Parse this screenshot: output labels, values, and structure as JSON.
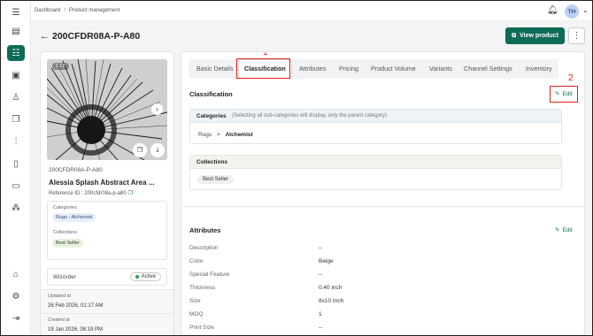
{
  "breadcrumb": {
    "root": "Dashboard",
    "sep": "/",
    "current": "Product management"
  },
  "user": {
    "initials": "TH"
  },
  "page": {
    "title": "200CFDR08A-P-A80",
    "view_button": "View product"
  },
  "product": {
    "image_counter": "1 / 2",
    "sku": "200CFDR08A-P-A80",
    "name": "Alessia Splash Abstract Area ...",
    "reference": "Reference ID : 200cfdr08a-p-a80",
    "categories_label": "Categories",
    "category_parent": "Rugs",
    "category_child": "Alchemist",
    "collections_label": "Collections",
    "collection": "Best Seller",
    "wizorder_label": "Wizorder",
    "status": "Active",
    "updated_label": "Updated at",
    "updated_value": "26 Feb 2026, 01:17 AM",
    "created_label": "Created at",
    "created_value": "19 Jan 2026, 08:19 PM"
  },
  "tabs": [
    "Basic Details",
    "Classification",
    "Attributes",
    "Pricing",
    "Product Volume",
    "Variants",
    "Channel Settings",
    "Inventory"
  ],
  "active_tab": "Classification",
  "annotations": {
    "n1": "1",
    "n2": "2"
  },
  "classification": {
    "heading": "Classification",
    "edit": "Edit",
    "categories_title": "Categories",
    "categories_note": "(Selecting all sub-categories will display, only the parent category)",
    "path_parent": "Rugs",
    "path_sep": ">",
    "path_child": "Alchemist",
    "collections_title": "Collections",
    "collection_chip": "Best Seller"
  },
  "attributes": {
    "heading": "Attributes",
    "edit": "Edit",
    "rows": [
      {
        "label": "Description",
        "value": "--"
      },
      {
        "label": "Color",
        "value": "Beige"
      },
      {
        "label": "Special Feature",
        "value": "--"
      },
      {
        "label": "Thickness",
        "value": "0.40 inch"
      },
      {
        "label": "Size",
        "value": "8x10 Inch"
      },
      {
        "label": "MOQ",
        "value": "1"
      },
      {
        "label": "Print Size",
        "value": "--"
      }
    ]
  },
  "colors": {
    "brand": "#0f6b57",
    "annotation": "#e02020"
  }
}
